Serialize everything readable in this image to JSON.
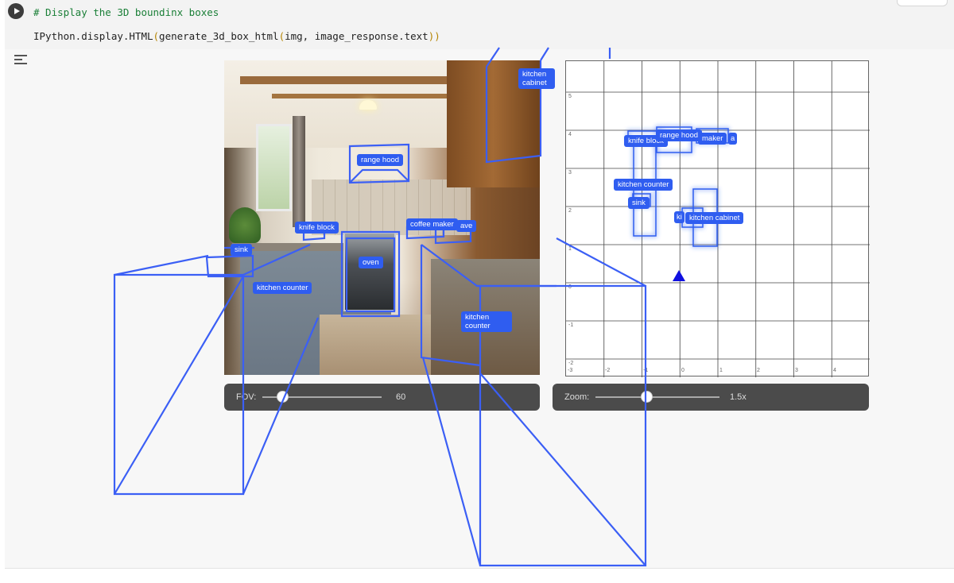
{
  "cell": {
    "code_comment": "# Display the 3D boundinx boxes",
    "code_call_prefix": "IPython.display.HTML",
    "code_call_open1": "(",
    "code_call_fn": "generate_3d_box_html",
    "code_call_open2": "(",
    "code_call_args": "img, image_response.text",
    "code_call_close": "))"
  },
  "photo_labels": {
    "kitchen_cabinet_top": "kitchen cabinet",
    "range_hood": "range hood",
    "knife_block": "knife block",
    "coffee_maker": "coffee maker",
    "microwave_partial": "ave",
    "sink": "sink",
    "oven": "oven",
    "kitchen_counter_left": "kitchen counter",
    "kitchen_counter_right": "kitchen counter"
  },
  "fov_control": {
    "label": "FOV:",
    "value": "60"
  },
  "zoom_control": {
    "label": "Zoom:",
    "value": "1.5x"
  },
  "topdown": {
    "y_ticks": [
      "5",
      "4",
      "3",
      "2",
      "1",
      "0",
      "-1",
      "-2"
    ],
    "x_ticks": [
      "-3",
      "-2",
      "-1",
      "0",
      "1",
      "2",
      "3",
      "4"
    ],
    "labels": {
      "knife_block": "knife block",
      "range_hood": "range hood",
      "coffee_maker_partial": "maker",
      "microwave_partial": "a",
      "kitchen_counter": "kitchen counter",
      "sink": "sink",
      "kitchen_cabinet": "kitchen cabinet",
      "ki_partial": "ki"
    }
  },
  "colors": {
    "box_blue": "#2f5df0",
    "panel_gray": "#4b4b4b",
    "camera_marker": "#1010e0"
  }
}
